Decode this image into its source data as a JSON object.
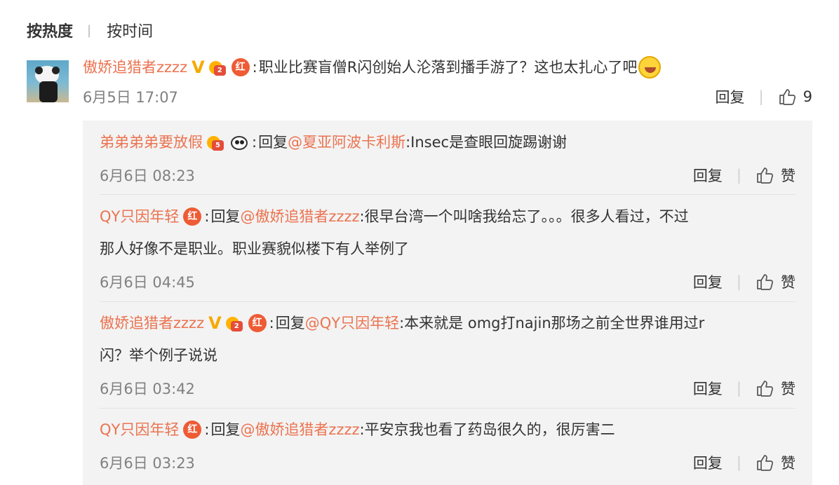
{
  "sort": {
    "hot_label": "按热度",
    "time_label": "按时间"
  },
  "main": {
    "username": "傲娇追猎者zzzz",
    "crown_badge": "2",
    "red_badge": "红",
    "text": "职业比赛盲僧R闪创始人沦落到播手游了？这也太扎心了吧",
    "date": "6月5日 17:07",
    "reply_label": "回复",
    "like_count": "9"
  },
  "replies": [
    {
      "username": "弟弟弟弟要放假",
      "crown_badge": "5",
      "prefix": "回复",
      "mention": "@夏亚阿波卡利斯",
      "text": ":Insec是查眼回旋踢谢谢",
      "date": "6月6日 08:23",
      "reply_label": "回复",
      "like_label": "赞"
    },
    {
      "username": "QY只因年轻",
      "red_badge": "红",
      "prefix": "回复",
      "mention": "@傲娇追猎者zzzz",
      "text": ":很早台湾一个叫啥我给忘了。。。很多人看过，不过",
      "text2": "那人好像不是职业。职业赛貌似楼下有人举例了",
      "date": "6月6日 04:45",
      "reply_label": "回复",
      "like_label": "赞"
    },
    {
      "username": "傲娇追猎者zzzz",
      "crown_badge": "2",
      "red_badge": "红",
      "prefix": "回复",
      "mention": "@QY只因年轻",
      "text": ":本来就是 omg打najin那场之前全世界谁用过r",
      "text2": "闪？举个例子说说",
      "date": "6月6日 03:42",
      "reply_label": "回复",
      "like_label": "赞"
    },
    {
      "username": "QY只因年轻",
      "red_badge": "红",
      "prefix": "回复",
      "mention": "@傲娇追猎者zzzz",
      "text": ":平安京我也看了药岛很久的，很厉害二",
      "date": "6月6日 03:23",
      "reply_label": "回复",
      "like_label": "赞"
    }
  ],
  "colors": {
    "username": "#eb7350",
    "meta": "#808080",
    "reply_bg": "#f3f3f3",
    "vip": "#f6a900"
  },
  "icons": [
    "thumbs-up-icon",
    "verified-v-icon",
    "crown-badge-icon",
    "red-badge-icon",
    "panda-icon",
    "laugh-cry-emoji-icon"
  ]
}
